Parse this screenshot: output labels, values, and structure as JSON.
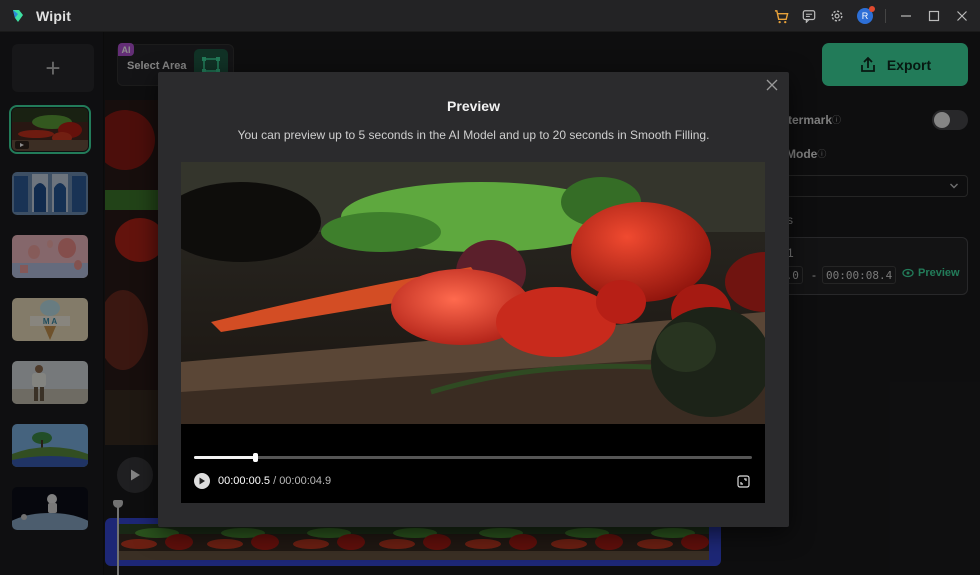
{
  "app": {
    "title": "Wipit"
  },
  "colors": {
    "accent": "#3fe0a3",
    "ai_badge": "#b455d8",
    "timeline": "#3547d8"
  },
  "titlebar_icons": [
    "cart-icon",
    "feedback-icon",
    "settings-icon",
    "avatar",
    "minimize-icon",
    "maximize-icon",
    "close-icon"
  ],
  "avatar": {
    "initial": "R"
  },
  "sidebar": {
    "add_label": "+"
  },
  "toolbar": {
    "ai_badge": "AI",
    "select_area_label": "Select Area"
  },
  "right_panel": {
    "export_label": "Export",
    "watermark_label": "termark",
    "mode_label": "Mode",
    "section_label": "s",
    "segment": {
      "name": "n 1",
      "start": "0.0",
      "separator": "-",
      "end": "00:00:08.4",
      "preview_label": "Preview"
    }
  },
  "modal": {
    "title": "Preview",
    "description": "You can preview up to 5 seconds in the AI Model and up to 20 seconds in Smooth Filling.",
    "player": {
      "current_time": "00:00:00.5",
      "separator": "/",
      "duration": "00:00:04.9",
      "progress_fraction": 0.11
    }
  }
}
